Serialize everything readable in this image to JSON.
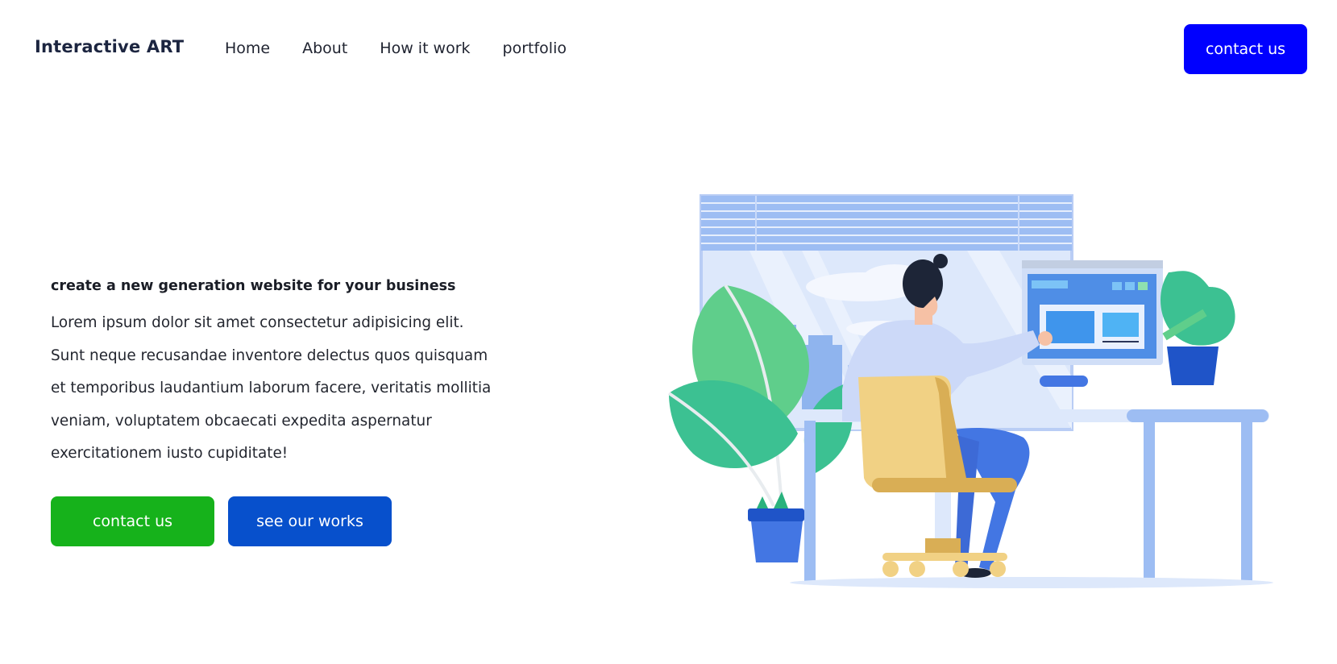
{
  "nav": {
    "logo": "Interactive ART",
    "links": [
      "Home",
      "About",
      "How it work",
      "portfolio"
    ],
    "cta_label": "contact us"
  },
  "hero": {
    "title": "create a new generation website for your business",
    "body": "Lorem ipsum dolor sit amet consectetur adipisicing elit. Sunt neque recusandae inventore delectus quos quisquam et temporibus laudantium laborum facere, veritatis mollitia veniam, voluptatem obcaecati expedita aspernatur exercitationem iusto cupiditate!",
    "buttons": {
      "primary_label": "contact us",
      "secondary_label": "see our works"
    }
  },
  "colors": {
    "nav_cta": "#0000ff",
    "primary_button": "#16b21b",
    "secondary_button": "#0750cc"
  }
}
